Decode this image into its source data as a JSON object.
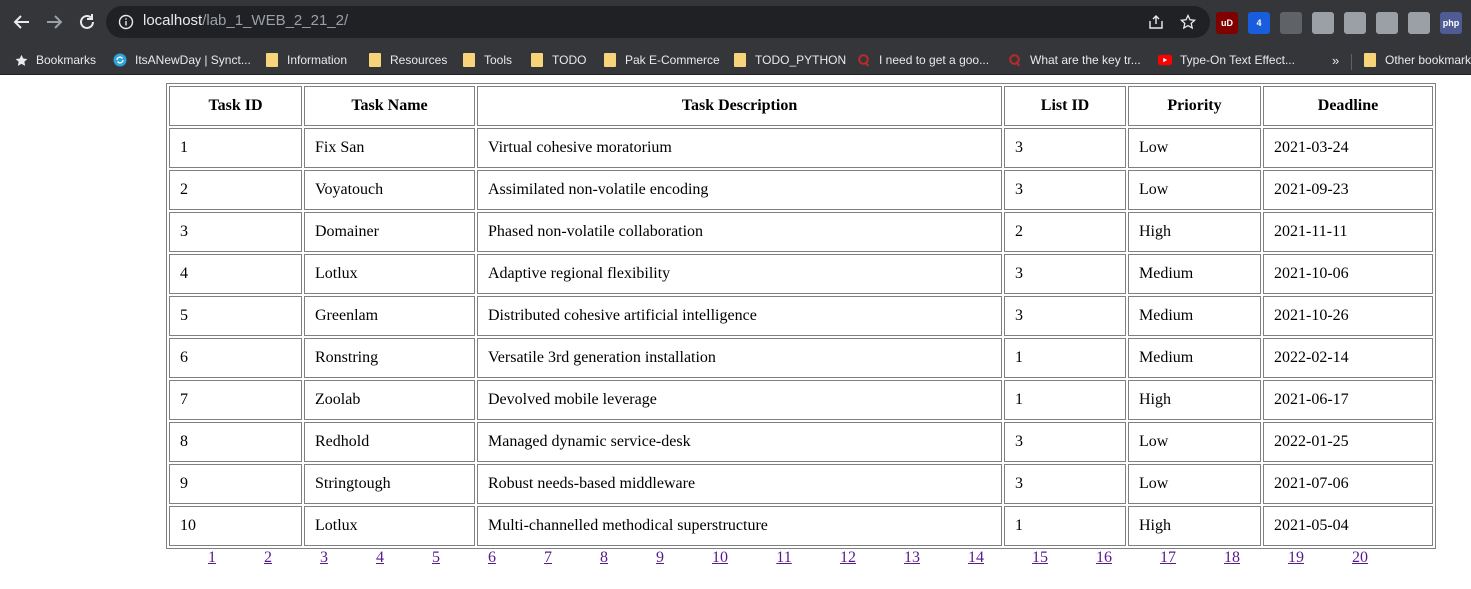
{
  "browser": {
    "url_host": "localhost",
    "url_path": "/lab_1_WEB_2_21_2/",
    "extensions": [
      {
        "name": "ublock-origin-icon",
        "label": "uD",
        "color": "#800000"
      },
      {
        "name": "bitwarden-icon",
        "label": "4",
        "color": "#175ddc"
      },
      {
        "name": "copy-extension-icon",
        "label": "",
        "color": "#5f6368"
      },
      {
        "name": "circle-extension-icon",
        "label": "",
        "color": "#9aa0a6"
      },
      {
        "name": "camera-extension-icon",
        "label": "",
        "color": "#9aa0a6"
      },
      {
        "name": "cloud-extension-icon",
        "label": "",
        "color": "#9aa0a6"
      },
      {
        "name": "screen-extension-icon",
        "label": "",
        "color": "#9aa0a6"
      },
      {
        "name": "php-extension-icon",
        "label": "php",
        "color": "#4f5b93"
      }
    ]
  },
  "bookmarks": {
    "items": [
      {
        "label": "Bookmarks",
        "icon": "star-icon"
      },
      {
        "label": "ItsANewDay | Synct...",
        "icon": "site-favicon-icon"
      },
      {
        "label": "Information",
        "icon": "folder-icon"
      },
      {
        "label": "Resources",
        "icon": "folder-icon"
      },
      {
        "label": "Tools",
        "icon": "folder-icon"
      },
      {
        "label": "TODO",
        "icon": "folder-icon"
      },
      {
        "label": "Pak E-Commerce",
        "icon": "folder-icon"
      },
      {
        "label": "TODO_PYTHON",
        "icon": "folder-icon"
      },
      {
        "label": "I need to get a goo...",
        "icon": "quora-icon"
      },
      {
        "label": "What are the key tr...",
        "icon": "quora-icon"
      },
      {
        "label": "Type-On Text Effect...",
        "icon": "youtube-icon"
      }
    ],
    "overflow": "»",
    "other": "Other bookmarks"
  },
  "table": {
    "headers": [
      "Task ID",
      "Task Name",
      "Task Description",
      "List ID",
      "Priority",
      "Deadline"
    ],
    "rows": [
      [
        "1",
        "Fix San",
        "Virtual cohesive moratorium",
        "3",
        "Low",
        "2021-03-24"
      ],
      [
        "2",
        "Voyatouch",
        "Assimilated non-volatile encoding",
        "3",
        "Low",
        "2021-09-23"
      ],
      [
        "3",
        "Domainer",
        "Phased non-volatile collaboration",
        "2",
        "High",
        "2021-11-11"
      ],
      [
        "4",
        "Lotlux",
        "Adaptive regional flexibility",
        "3",
        "Medium",
        "2021-10-06"
      ],
      [
        "5",
        "Greenlam",
        "Distributed cohesive artificial intelligence",
        "3",
        "Medium",
        "2021-10-26"
      ],
      [
        "6",
        "Ronstring",
        "Versatile 3rd generation installation",
        "1",
        "Medium",
        "2022-02-14"
      ],
      [
        "7",
        "Zoolab",
        "Devolved mobile leverage",
        "1",
        "High",
        "2021-06-17"
      ],
      [
        "8",
        "Redhold",
        "Managed dynamic service-desk",
        "3",
        "Low",
        "2022-01-25"
      ],
      [
        "9",
        "Stringtough",
        "Robust needs-based middleware",
        "3",
        "Low",
        "2021-07-06"
      ],
      [
        "10",
        "Lotlux",
        "Multi-channelled methodical superstructure",
        "1",
        "High",
        "2021-05-04"
      ]
    ]
  },
  "pagination": {
    "pages": [
      "1",
      "2",
      "3",
      "4",
      "5",
      "6",
      "7",
      "8",
      "9",
      "10",
      "11",
      "12",
      "13",
      "14",
      "15",
      "16",
      "17",
      "18",
      "19",
      "20"
    ],
    "link_color": "#551a8b"
  }
}
